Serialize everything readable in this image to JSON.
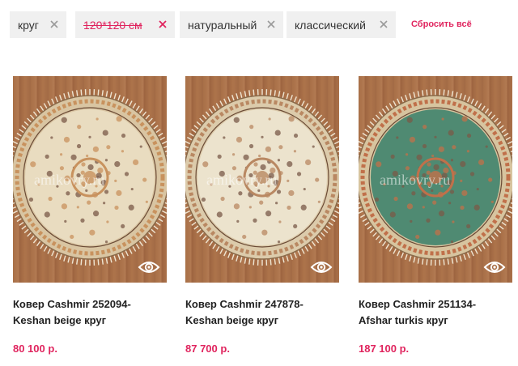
{
  "filters": {
    "chips": [
      {
        "label": "круг",
        "active_strike": false
      },
      {
        "label": "120*120 см",
        "active_strike": true
      },
      {
        "label": "натуральный",
        "active_strike": false
      },
      {
        "label": "классический",
        "active_strike": false
      }
    ],
    "reset_label": "Сбросить всё",
    "remove_icon": "close-icon"
  },
  "colors": {
    "accent": "#e0245e",
    "chip_bg": "#f0f0f0",
    "floor": "#a86f47"
  },
  "products": [
    {
      "title_line1": "Ковер Cashmir 252094-",
      "title_line2": "Keshan beige круг",
      "price": "80 100 р.",
      "watermark": "amikovry.ru",
      "field_color": "#e9dcc0",
      "border_color": "#d9c5a2",
      "accent_color": "#c8925e",
      "view_icon": "eye-icon"
    },
    {
      "title_line1": "Ковер Cashmir 247878-",
      "title_line2": "Keshan beige круг",
      "price": "87 700 р.",
      "watermark": "amikovry.ru",
      "field_color": "#ece3cd",
      "border_color": "#dccbab",
      "accent_color": "#b98862",
      "view_icon": "eye-icon"
    },
    {
      "title_line1": "Ковер Cashmir 251134-",
      "title_line2": "Afshar turkis круг",
      "price": "187 100 р.",
      "watermark": "amikovry.ru",
      "field_color": "#4f8a72",
      "border_color": "#d7c49f",
      "accent_color": "#c0704a",
      "view_icon": "eye-icon"
    }
  ]
}
